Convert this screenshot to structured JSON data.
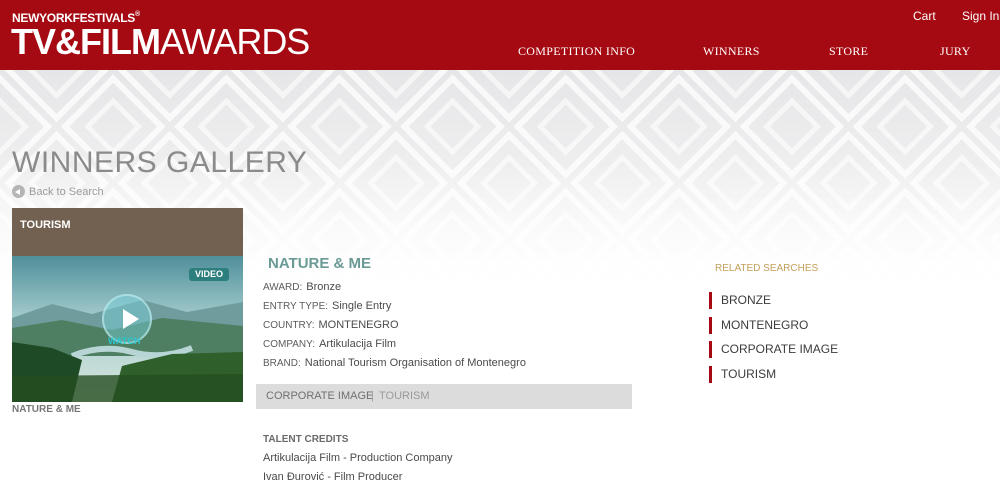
{
  "brand": {
    "top_line": "NEWYORKFESTIVALS",
    "reg_mark": "®",
    "main_bold": "TV&FILM",
    "main_light": "AWARDS"
  },
  "header": {
    "cart_label": "Cart",
    "signin_label": "Sign In",
    "nav": [
      "COMPETITION INFO",
      "WINNERS",
      "STORE",
      "JURY"
    ],
    "accent_color": "#a50a12"
  },
  "page": {
    "title": "WINNERS GALLERY",
    "back_label": "Back to Search"
  },
  "card": {
    "category": "TOURISM",
    "video_badge": "VIDEO",
    "watch_label": "WATCH",
    "caption": "NATURE & ME"
  },
  "entry": {
    "title": "NATURE & ME",
    "fields": [
      {
        "label": "AWARD",
        "value": "Bronze"
      },
      {
        "label": "ENTRY TYPE",
        "value": "Single Entry"
      },
      {
        "label": "COUNTRY",
        "value": "MONTENEGRO"
      },
      {
        "label": "COMPANY",
        "value": "Artikulacija Film"
      },
      {
        "label": "BRAND",
        "value": "National Tourism Organisation of Montenegro"
      }
    ],
    "category_primary": "CORPORATE IMAGE",
    "category_separator": "|",
    "category_secondary": "TOURISM",
    "talent_heading": "TALENT CREDITS",
    "talent": [
      "Artikulacija Film - Production Company",
      "Ivan Đurović - Film Producer"
    ]
  },
  "related": {
    "heading": "RELATED SEARCHES",
    "items": [
      "BRONZE",
      "MONTENEGRO",
      "CORPORATE IMAGE",
      "TOURISM"
    ]
  }
}
